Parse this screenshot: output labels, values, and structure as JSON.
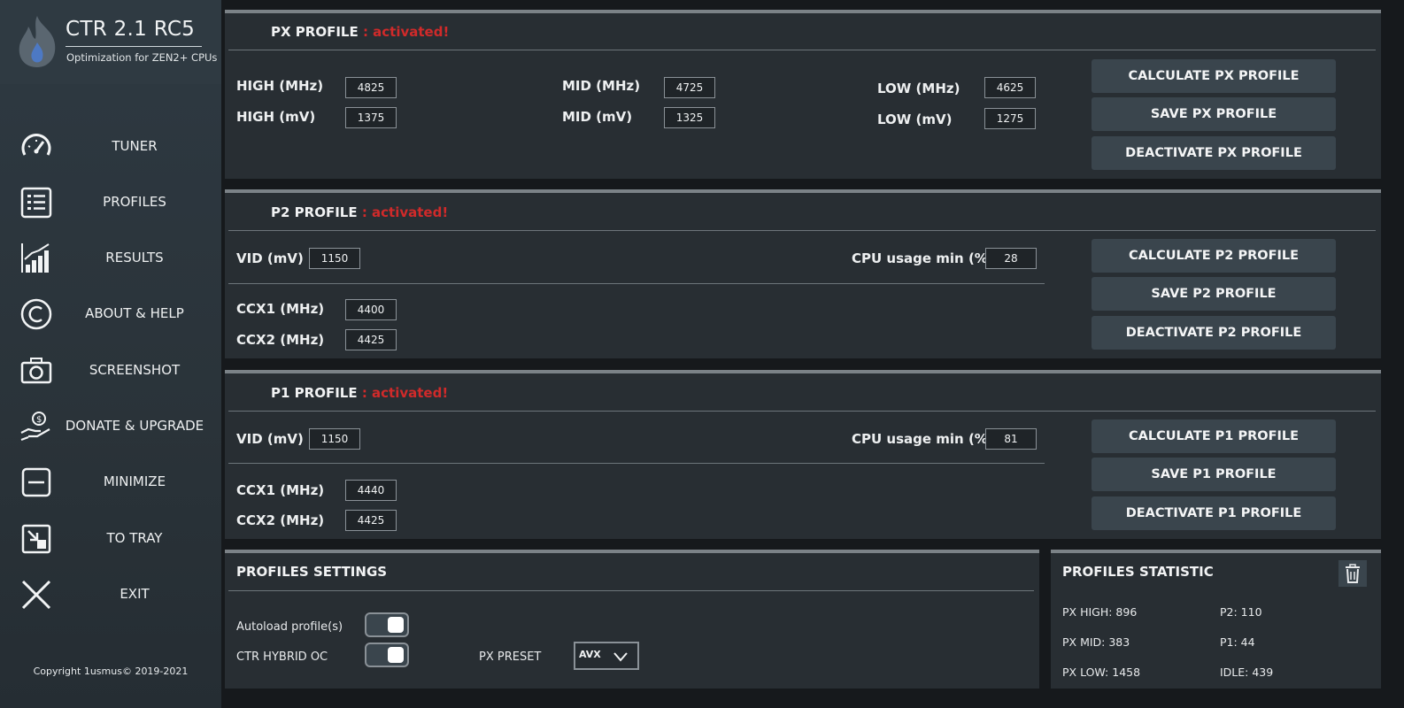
{
  "app": {
    "title": "CTR 2.1 RC5",
    "subtitle": "Optimization for ZEN2+ CPUs",
    "copyright": "Copyright 1usmus© 2019-2021",
    "accent_color": "#d02a2a",
    "flame_color": "#4d79c4"
  },
  "sidebar": {
    "items": [
      {
        "label": "TUNER",
        "icon": "speedometer-icon"
      },
      {
        "label": "PROFILES",
        "icon": "list-icon"
      },
      {
        "label": "RESULTS",
        "icon": "bar-chart-icon"
      },
      {
        "label": "ABOUT & HELP",
        "icon": "copyright-icon"
      },
      {
        "label": "SCREENSHOT",
        "icon": "camera-icon"
      },
      {
        "label": "DONATE & UPGRADE",
        "icon": "donate-icon"
      },
      {
        "label": "MINIMIZE",
        "icon": "minimize-icon"
      },
      {
        "label": "TO TRAY",
        "icon": "tray-icon"
      },
      {
        "label": "EXIT",
        "icon": "close-icon"
      }
    ]
  },
  "px": {
    "title": "PX PROFILE",
    "status": " : activated!",
    "high_mhz_label": "HIGH (MHz)",
    "high_mhz": "4825",
    "high_mv_label": "HIGH  (mV)",
    "high_mv": "1375",
    "mid_mhz_label": "MID (MHz)",
    "mid_mhz": "4725",
    "mid_mv_label": "MID (mV)",
    "mid_mv": "1325",
    "low_mhz_label": "LOW (MHz)",
    "low_mhz": "4625",
    "low_mv_label": "LOW (mV)",
    "low_mv": "1275",
    "calc_btn": "CALCULATE PX PROFILE",
    "save_btn": "SAVE PX PROFILE",
    "deact_btn": "DEACTIVATE PX PROFILE"
  },
  "p2": {
    "title": "P2 PROFILE",
    "status": " : activated!",
    "vid_label": "VID (mV)",
    "vid": "1150",
    "cpu_label": "CPU usage min (%)",
    "cpu": "28",
    "ccx1_label": "CCX1 (MHz)",
    "ccx1": "4400",
    "ccx2_label": "CCX2 (MHz)",
    "ccx2": "4425",
    "calc_btn": "CALCULATE P2 PROFILE",
    "save_btn": "SAVE P2 PROFILE",
    "deact_btn": "DEACTIVATE P2 PROFILE"
  },
  "p1": {
    "title": "P1 PROFILE",
    "status": " : activated!",
    "vid_label": "VID (mV)",
    "vid": "1150",
    "cpu_label": "CPU usage min (%)",
    "cpu": "81",
    "ccx1_label": "CCX1 (MHz)",
    "ccx1": "4440",
    "ccx2_label": "CCX2 (MHz)",
    "ccx2": "4425",
    "calc_btn": "CALCULATE P1 PROFILE",
    "save_btn": "SAVE P1 PROFILE",
    "deact_btn": "DEACTIVATE P1 PROFILE"
  },
  "settings": {
    "title": "PROFILES SETTINGS",
    "autoload_label": "Autoload profile(s)",
    "hybrid_label": "CTR HYBRID OC",
    "preset_label": "PX PRESET",
    "preset_value": "AVX"
  },
  "statistic": {
    "title": "PROFILES STATISTIC",
    "px_high": "PX HIGH: 896",
    "px_mid": "PX MID: 383",
    "px_low": "PX LOW: 1458",
    "p2": "P2: 110",
    "p1": "P1: 44",
    "idle": "IDLE: 439"
  }
}
